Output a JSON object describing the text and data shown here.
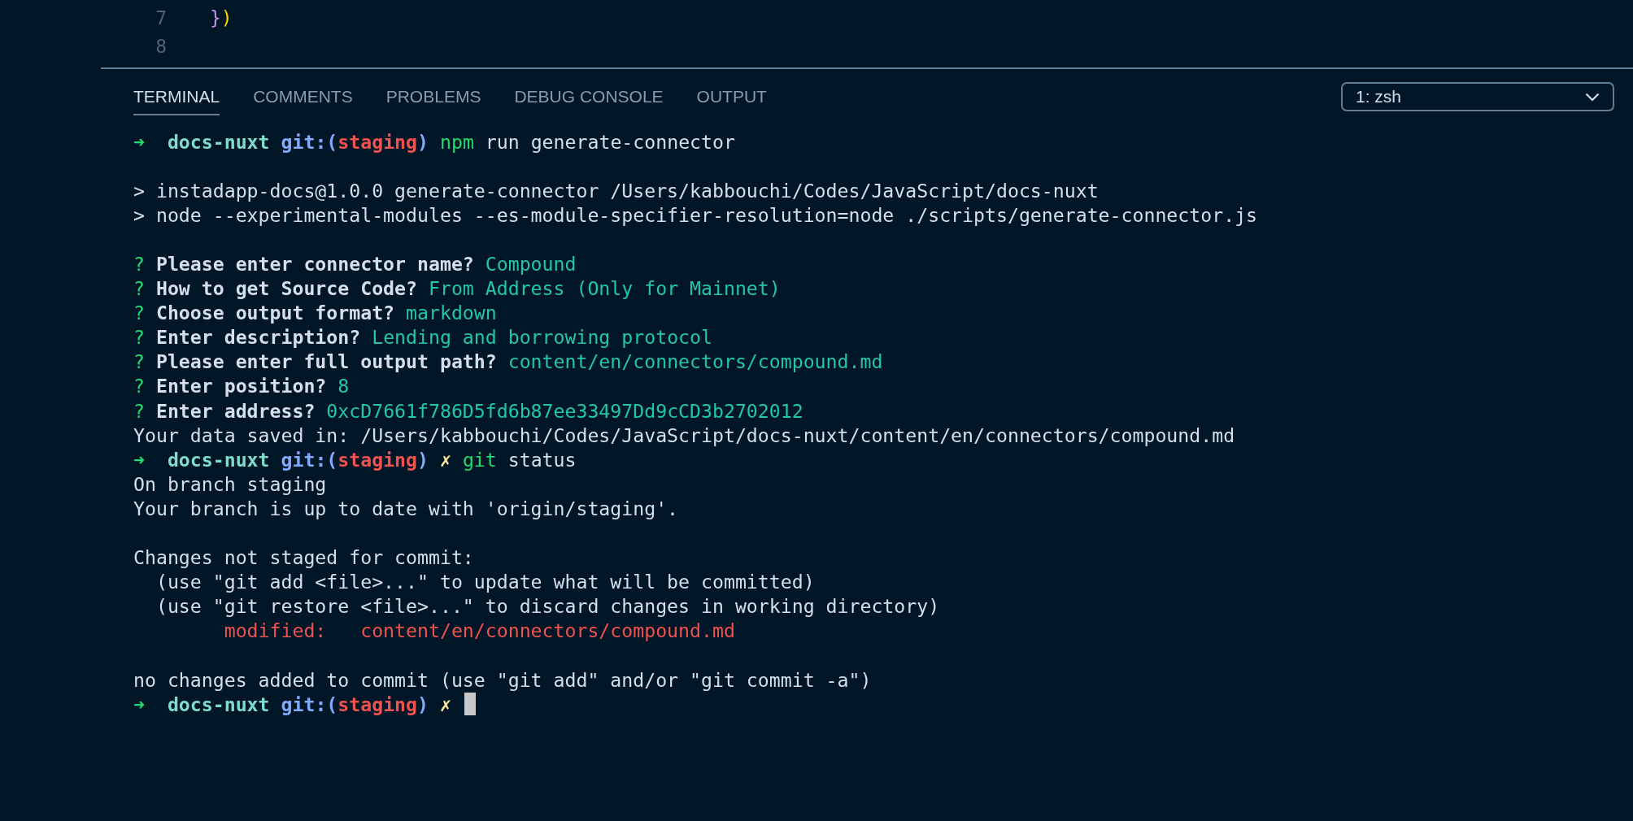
{
  "editor": {
    "lines": [
      {
        "number": "7",
        "code": [
          {
            "kind": "brace",
            "text": "}"
          },
          {
            "kind": "paren",
            "text": ")"
          }
        ]
      },
      {
        "number": "8"
      }
    ]
  },
  "panel": {
    "tabs": [
      {
        "label": "TERMINAL",
        "selected": true
      },
      {
        "label": "COMMENTS",
        "selected": false
      },
      {
        "label": "PROBLEMS",
        "selected": false
      },
      {
        "label": "DEBUG CONSOLE",
        "selected": false
      },
      {
        "label": "OUTPUT",
        "selected": false
      }
    ],
    "terminal_select": {
      "value": "1: zsh"
    },
    "terminal": {
      "lines": [
        {
          "kind": "output",
          "segments": [
            {
              "kind": "arrow",
              "text": "➜  "
            },
            {
              "kind": "dir",
              "text": "docs-nuxt "
            },
            {
              "kind": "git",
              "text": "git:("
            },
            {
              "kind": "branch",
              "text": "staging"
            },
            {
              "kind": "git",
              "text": ") "
            },
            {
              "kind": "cmd",
              "text": "npm"
            },
            {
              "kind": "text",
              "text": " run generate-connector"
            }
          ]
        },
        {
          "kind": "blank"
        },
        {
          "kind": "output",
          "segments": [
            {
              "kind": "text",
              "text": "> instadapp-docs@1.0.0 generate-connector /Users/kabbouchi/Codes/JavaScript/docs-nuxt"
            }
          ]
        },
        {
          "kind": "output",
          "segments": [
            {
              "kind": "text",
              "text": "> node --experimental-modules --es-module-specifier-resolution=node ./scripts/generate-connector.js"
            }
          ]
        },
        {
          "kind": "blank"
        },
        {
          "kind": "output",
          "segments": [
            {
              "kind": "question",
              "text": "? "
            },
            {
              "kind": "label",
              "text": "Please enter connector name? "
            },
            {
              "kind": "answer",
              "text": "Compound"
            }
          ]
        },
        {
          "kind": "output",
          "segments": [
            {
              "kind": "question",
              "text": "? "
            },
            {
              "kind": "label",
              "text": "How to get Source Code? "
            },
            {
              "kind": "answer",
              "text": "From Address (Only for Mainnet)"
            }
          ]
        },
        {
          "kind": "output",
          "segments": [
            {
              "kind": "question",
              "text": "? "
            },
            {
              "kind": "label",
              "text": "Choose output format? "
            },
            {
              "kind": "answer",
              "text": "markdown"
            }
          ]
        },
        {
          "kind": "output",
          "segments": [
            {
              "kind": "question",
              "text": "? "
            },
            {
              "kind": "label",
              "text": "Enter description? "
            },
            {
              "kind": "answer",
              "text": "Lending and borrowing protocol"
            }
          ]
        },
        {
          "kind": "output",
          "segments": [
            {
              "kind": "question",
              "text": "? "
            },
            {
              "kind": "label",
              "text": "Please enter full output path? "
            },
            {
              "kind": "answer",
              "text": "content/en/connectors/compound.md"
            }
          ]
        },
        {
          "kind": "output",
          "segments": [
            {
              "kind": "question",
              "text": "? "
            },
            {
              "kind": "label",
              "text": "Enter position? "
            },
            {
              "kind": "answer",
              "text": "8"
            }
          ]
        },
        {
          "kind": "output",
          "segments": [
            {
              "kind": "question",
              "text": "? "
            },
            {
              "kind": "label",
              "text": "Enter address? "
            },
            {
              "kind": "answer",
              "text": "0xcD7661f786D5fd6b87ee33497Dd9cCD3b2702012"
            }
          ]
        },
        {
          "kind": "output",
          "segments": [
            {
              "kind": "text",
              "text": "Your data saved in: /Users/kabbouchi/Codes/JavaScript/docs-nuxt/content/en/connectors/compound.md"
            }
          ]
        },
        {
          "kind": "output",
          "segments": [
            {
              "kind": "arrow",
              "text": "➜  "
            },
            {
              "kind": "dir",
              "text": "docs-nuxt "
            },
            {
              "kind": "git",
              "text": "git:("
            },
            {
              "kind": "branch",
              "text": "staging"
            },
            {
              "kind": "git",
              "text": ") "
            },
            {
              "kind": "dirty",
              "text": "✗ "
            },
            {
              "kind": "cmd",
              "text": "git"
            },
            {
              "kind": "text",
              "text": " status"
            }
          ]
        },
        {
          "kind": "output",
          "segments": [
            {
              "kind": "text",
              "text": "On branch staging"
            }
          ]
        },
        {
          "kind": "output",
          "segments": [
            {
              "kind": "text",
              "text": "Your branch is up to date with 'origin/staging'."
            }
          ]
        },
        {
          "kind": "blank"
        },
        {
          "kind": "output",
          "segments": [
            {
              "kind": "text",
              "text": "Changes not staged for commit:"
            }
          ]
        },
        {
          "kind": "output",
          "segments": [
            {
              "kind": "text",
              "text": "  (use \"git add <file>...\" to update what will be committed)"
            }
          ]
        },
        {
          "kind": "output",
          "segments": [
            {
              "kind": "text",
              "text": "  (use \"git restore <file>...\" to discard changes in working directory)"
            }
          ]
        },
        {
          "kind": "output",
          "segments": [
            {
              "kind": "error",
              "text": "        modified:   content/en/connectors/compound.md"
            }
          ]
        },
        {
          "kind": "blank"
        },
        {
          "kind": "output",
          "segments": [
            {
              "kind": "text",
              "text": "no changes added to commit (use \"git add\" and/or \"git commit -a\")"
            }
          ]
        },
        {
          "kind": "output",
          "cursor": true,
          "segments": [
            {
              "kind": "arrow",
              "text": "➜  "
            },
            {
              "kind": "dir",
              "text": "docs-nuxt "
            },
            {
              "kind": "git",
              "text": "git:("
            },
            {
              "kind": "branch",
              "text": "staging"
            },
            {
              "kind": "git",
              "text": ") "
            },
            {
              "kind": "dirty",
              "text": "✗ "
            }
          ]
        }
      ]
    }
  }
}
